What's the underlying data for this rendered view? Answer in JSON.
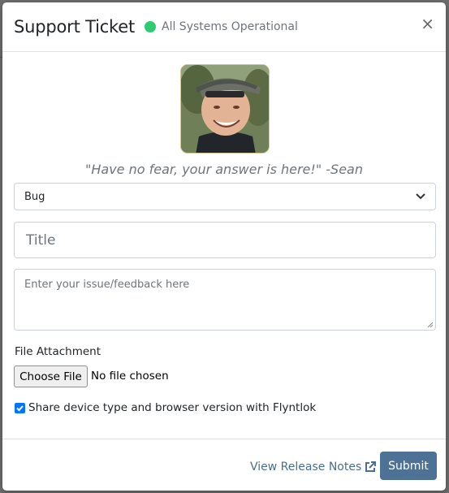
{
  "modal": {
    "title": "Support Ticket",
    "status": {
      "text": "All Systems Operational",
      "color": "#2ecc71"
    },
    "close_label": "×"
  },
  "quote": "\"Have no fear, your answer is here!\" -Sean",
  "form": {
    "type_select": {
      "value": "Bug"
    },
    "title_input": {
      "placeholder": "Title"
    },
    "issue_textarea": {
      "placeholder": "Enter your issue/feedback here"
    },
    "file_attachment": {
      "label": "File Attachment",
      "button_label": "Choose File",
      "status": "No file chosen"
    },
    "share_checkbox": {
      "checked": true,
      "label": "Share device type and browser version with Flyntlok"
    }
  },
  "footer": {
    "release_notes_label": "View Release Notes",
    "release_notes_icon": "external-link-icon",
    "submit_label": "Submit"
  },
  "colors": {
    "accent": "#4d7296",
    "link": "#4a6f8f"
  }
}
